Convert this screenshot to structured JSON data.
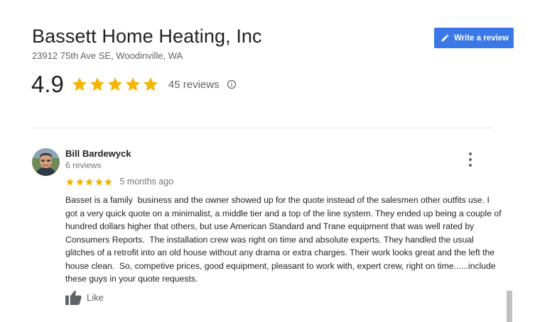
{
  "business": {
    "name": "Bassett Home Heating, Inc",
    "address": "23912 75th Ave SE, Woodinville, WA",
    "rating": "4.9",
    "rating_stars": 5,
    "reviews_count": "45 reviews"
  },
  "actions": {
    "write_review_label": "Write a review"
  },
  "review": {
    "reviewer_name": "Bill Bardewyck",
    "reviewer_meta": "6 reviews",
    "stars": 5,
    "date": "5 months ago",
    "text": "Basset is a family  business and the owner showed up for the quote instead of the salesmen other outfits use. I got a very quick quote on a minimalist, a middle tier and a top of the line system. They ended up being a couple of hundred dollars higher that others, but use American Standard and Trane equipment that was well rated by Consumers Reports.  The installation crew was right on time and absolute experts. They handled the usual glitches of a retrofit into an old house without any drama or extra charges. Their work looks great and the left the house clean.  So, competive prices, good equipment, pleasant to work with, expert crew, right on time......include these guys in your quote requests.",
    "like_label": "Like"
  },
  "colors": {
    "star": "#f4b400",
    "button_blue": "#3b78e7",
    "secondary_text": "#70757a"
  },
  "icons": {
    "write_review": "pencil-icon",
    "info": "info-icon",
    "more": "more-vert-icon",
    "like": "thumb-up-icon",
    "star": "star-icon"
  }
}
